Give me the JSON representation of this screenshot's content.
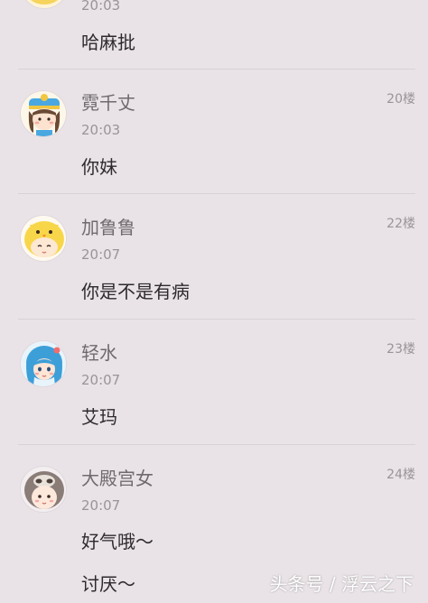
{
  "posts": [
    {
      "time": "20:03",
      "content": "哈麻批"
    },
    {
      "username": "霓千丈",
      "floor": "20楼",
      "time": "20:03",
      "content": "你妹",
      "avatar_icon": "girl-blue-hat-avatar"
    },
    {
      "username": "加鲁鲁",
      "floor": "22楼",
      "time": "20:07",
      "content": "你是不是有病",
      "avatar_icon": "yellow-chick-costume-avatar"
    },
    {
      "username": "轻水",
      "floor": "23楼",
      "time": "20:07",
      "content": "艾玛",
      "avatar_icon": "blue-hair-girl-avatar"
    },
    {
      "username": "大殿宫女",
      "floor": "24楼",
      "time": "20:07",
      "content": "好气哦～",
      "content_2": "讨厌～",
      "avatar_icon": "sloth-hood-avatar"
    }
  ],
  "watermark": "头条号 / 浮云之下",
  "colors": {
    "background": "#e9e3e7",
    "username": "#6f6a6e",
    "meta": "#9a9498",
    "content": "#2d2a2d",
    "divider": "#d8d1d5"
  }
}
